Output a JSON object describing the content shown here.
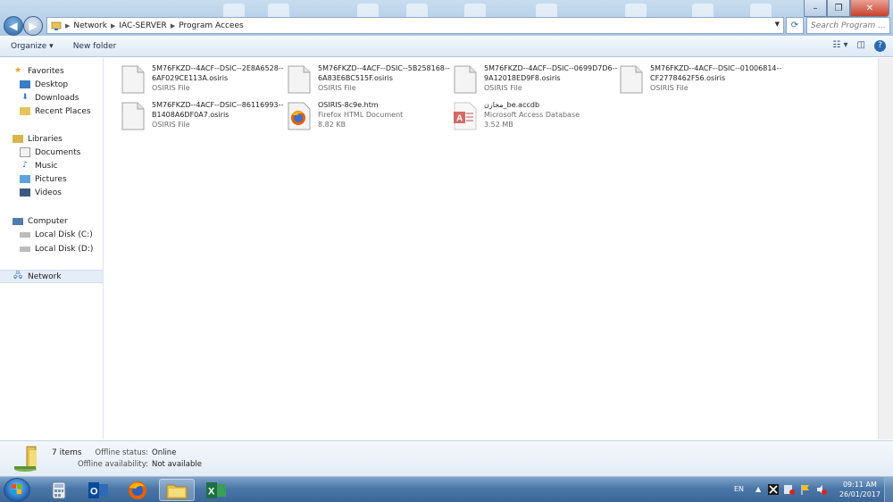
{
  "window": {
    "minimize": "–",
    "maximize": "❐",
    "close": "✕"
  },
  "address_bar": {
    "crumbs": [
      "Network",
      "IAC-SERVER",
      "Program Accees"
    ]
  },
  "search": {
    "placeholder": "Search Program ..."
  },
  "command_bar": {
    "organize": "Organize ▾",
    "new_folder": "New folder"
  },
  "sidebar": {
    "favorites": "Favorites",
    "desktop": "Desktop",
    "downloads": "Downloads",
    "recent_places": "Recent Places",
    "libraries": "Libraries",
    "documents": "Documents",
    "music": "Music",
    "pictures": "Pictures",
    "videos": "Videos",
    "computer": "Computer",
    "local_c": "Local Disk (C:)",
    "local_d": "Local Disk (D:)",
    "network": "Network"
  },
  "files": [
    {
      "name": "5M76FKZD--4ACF--DSIC--2E8A6528--6AF029CE113A.osiris",
      "type": "OSIRIS File",
      "size": ""
    },
    {
      "name": "5M76FKZD--4ACF--DSIC--5B258168--6A83E6BC515F.osiris",
      "type": "OSIRIS File",
      "size": ""
    },
    {
      "name": "5M76FKZD--4ACF--DSIC--0699D7D6--9A12018ED9F8.osiris",
      "type": "OSIRIS File",
      "size": ""
    },
    {
      "name": "5M76FKZD--4ACF--DSIC--01006814--CF2778462F56.osiris",
      "type": "OSIRIS File",
      "size": ""
    },
    {
      "name": "5M76FKZD--4ACF--DSIC--86116993--B1408A6DF0A7.osiris",
      "type": "OSIRIS File",
      "size": ""
    },
    {
      "name": "OSIRIS-8c9e.htm",
      "type": "Firefox HTML Document",
      "size": "8.82 KB"
    },
    {
      "name": "مخازن_be.accdb",
      "type": "Microsoft Access Database",
      "size": "3.52 MB"
    }
  ],
  "details": {
    "count": "7 items",
    "offline_status_label": "Offline status:",
    "offline_status_value": "Online",
    "offline_avail_label": "Offline availability:",
    "offline_avail_value": "Not available"
  },
  "taskbar": {
    "language": "EN",
    "time": "09:11 AM",
    "date": "26/01/2017"
  },
  "colors": {
    "taskbar": "#3b6699",
    "accent": "#2a5fa0"
  }
}
